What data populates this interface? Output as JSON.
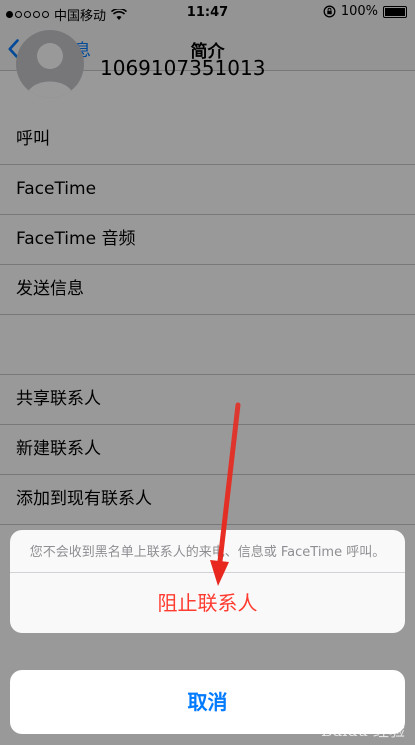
{
  "status_bar": {
    "carrier": "中国移动",
    "time": "11:47",
    "battery": "100%"
  },
  "nav": {
    "back_label": "详细信息",
    "title": "简介"
  },
  "contact": {
    "number": "1069107351013"
  },
  "actions": [
    "呼叫",
    "FaceTime",
    "FaceTime 音频",
    "发送信息"
  ],
  "contact_actions": [
    "共享联系人",
    "新建联系人",
    "添加到现有联系人"
  ],
  "action_sheet": {
    "message": "您不会收到黑名单上联系人的来电、信息或 FaceTime 呼叫。",
    "block_label": "阻止联系人",
    "cancel_label": "取消"
  },
  "watermark": "Baidu 经验",
  "colors": {
    "accent": "#007aff",
    "destructive": "#ff3b30",
    "annotation_arrow": "#e8281e"
  }
}
